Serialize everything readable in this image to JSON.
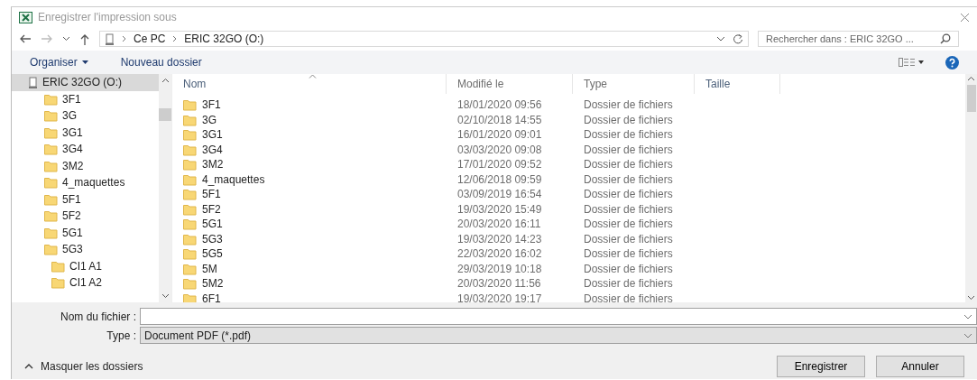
{
  "window": {
    "title": "Enregistrer l'impression sous"
  },
  "address": {
    "path": [
      "Ce PC",
      "ERIC 32GO (O:)"
    ]
  },
  "search": {
    "placeholder": "Rechercher dans : ERIC 32GO ..."
  },
  "toolbar": {
    "organize": "Organiser",
    "new_folder": "Nouveau dossier"
  },
  "nav_tree": [
    {
      "label": "ERIC 32GO (O:)",
      "kind": "drive",
      "selected": true,
      "children": [
        {
          "label": "3F1",
          "kind": "folder",
          "selected": false
        },
        {
          "label": "3G",
          "kind": "folder",
          "selected": false
        },
        {
          "label": "3G1",
          "kind": "folder",
          "selected": false
        },
        {
          "label": "3G4",
          "kind": "folder",
          "selected": false
        },
        {
          "label": "3M2",
          "kind": "folder",
          "selected": false
        },
        {
          "label": "4_maquettes",
          "kind": "folder",
          "selected": false
        },
        {
          "label": "5F1",
          "kind": "folder",
          "selected": false
        },
        {
          "label": "5F2",
          "kind": "folder",
          "selected": false
        },
        {
          "label": "5G1",
          "kind": "folder",
          "selected": false
        },
        {
          "label": "5G3",
          "kind": "folder",
          "selected": false,
          "children": [
            {
              "label": "CI1 A1",
              "kind": "folder",
              "selected": false
            },
            {
              "label": "CI1 A2",
              "kind": "folder",
              "selected": false
            }
          ]
        }
      ]
    }
  ],
  "columns": [
    "Nom",
    "Modifié le",
    "Type",
    "Taille"
  ],
  "rows": [
    {
      "name": "3F1",
      "modified": "18/01/2020 09:56",
      "type": "Dossier de fichiers"
    },
    {
      "name": "3G",
      "modified": "02/10/2018 14:55",
      "type": "Dossier de fichiers"
    },
    {
      "name": "3G1",
      "modified": "16/01/2020 09:01",
      "type": "Dossier de fichiers"
    },
    {
      "name": "3G4",
      "modified": "03/03/2020 09:08",
      "type": "Dossier de fichiers"
    },
    {
      "name": "3M2",
      "modified": "17/01/2020 09:52",
      "type": "Dossier de fichiers"
    },
    {
      "name": "4_maquettes",
      "modified": "12/06/2018 09:59",
      "type": "Dossier de fichiers"
    },
    {
      "name": "5F1",
      "modified": "03/09/2019 16:54",
      "type": "Dossier de fichiers"
    },
    {
      "name": "5F2",
      "modified": "19/03/2020 15:49",
      "type": "Dossier de fichiers"
    },
    {
      "name": "5G1",
      "modified": "20/03/2020 16:11",
      "type": "Dossier de fichiers"
    },
    {
      "name": "5G3",
      "modified": "19/03/2020 14:23",
      "type": "Dossier de fichiers"
    },
    {
      "name": "5G5",
      "modified": "22/03/2020 16:02",
      "type": "Dossier de fichiers"
    },
    {
      "name": "5M",
      "modified": "29/03/2019 10:18",
      "type": "Dossier de fichiers"
    },
    {
      "name": "5M2",
      "modified": "20/03/2020 11:56",
      "type": "Dossier de fichiers"
    },
    {
      "name": "6F1",
      "modified": "19/03/2020 19:17",
      "type": "Dossier de fichiers"
    }
  ],
  "filename": {
    "label": "Nom du fichier :"
  },
  "file_type": {
    "label": "Type :",
    "value": "Document PDF (*.pdf)"
  },
  "toggle_folders": "Masquer les dossiers",
  "buttons": [
    "Enregistrer",
    "Annuler"
  ]
}
